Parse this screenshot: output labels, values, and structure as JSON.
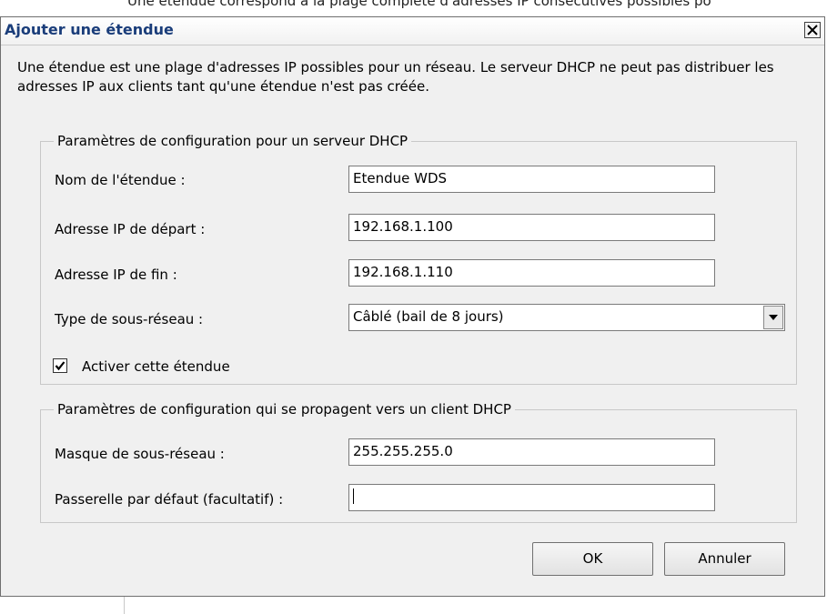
{
  "background": {
    "text": "Une étendue correspond à la plage complète d'adresses IP consécutives possibles po"
  },
  "dialog": {
    "title": "Ajouter une étendue",
    "close_label": "×",
    "intro": "Une étendue est une plage d'adresses IP possibles pour un réseau. Le serveur DHCP ne peut pas distribuer les adresses IP aux clients tant qu'une étendue n'est pas créée.",
    "group_server": {
      "legend": "Paramètres de configuration pour un serveur DHCP",
      "scope_name_label": "Nom de l'étendue :",
      "scope_name_value": "Etendue WDS",
      "start_ip_label": "Adresse IP de départ :",
      "start_ip_value": "192.168.1.100",
      "end_ip_label": "Adresse IP de fin :",
      "end_ip_value": "192.168.1.110",
      "subnet_type_label": "Type de sous-réseau :",
      "subnet_type_value": "Câblé (bail de 8 jours)",
      "activate_label": "Activer cette étendue",
      "activate_checked": true
    },
    "group_client": {
      "legend": "Paramètres de configuration qui se propagent vers un client DHCP",
      "mask_label": "Masque de sous-réseau :",
      "mask_value": "255.255.255.0",
      "gateway_label": "Passerelle par défaut (facultatif) :",
      "gateway_value": ""
    },
    "ok_label": "OK",
    "cancel_label": "Annuler"
  },
  "colors": {
    "title_text": "#1a3d7a",
    "dialog_bg": "#f0f0f0"
  }
}
